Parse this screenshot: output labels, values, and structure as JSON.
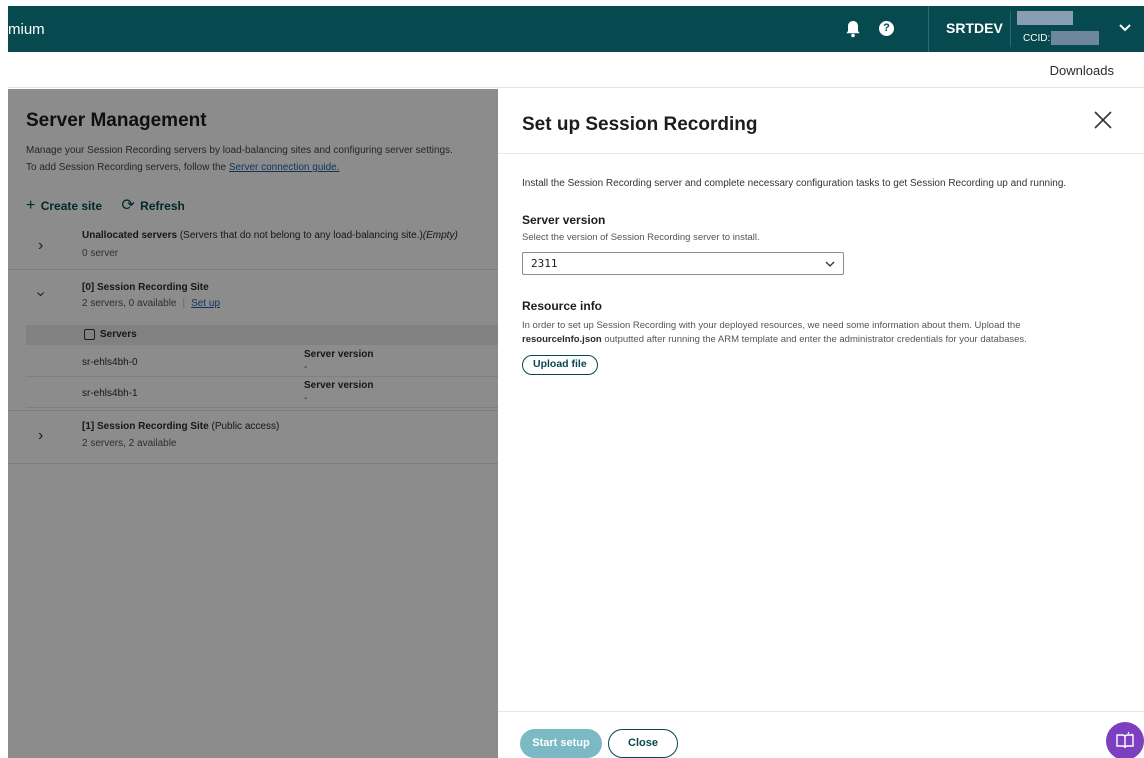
{
  "topbar": {
    "brand": "mium",
    "org": "SRTDEV",
    "ccid_label": "CCID:",
    "icons": [
      "bell-icon",
      "help-icon",
      "chevron-down-icon"
    ],
    "bg_color": "#06494f"
  },
  "subbar": {
    "downloads": "Downloads"
  },
  "left": {
    "title": "Server Management",
    "desc_line1": "Manage your Session Recording servers by load-balancing sites and configuring server settings.",
    "desc_line2_prefix": "To add Session Recording servers, follow the",
    "desc_link": "Server connection guide.",
    "create_site": "Create site",
    "refresh": "Refresh",
    "rows": [
      {
        "title": "Unallocated servers",
        "title_rest": "(Servers that do not belong to any load-balancing site.)",
        "empty": "(Empty)",
        "sub": "0 server"
      },
      {
        "title": "[0] Session Recording Site",
        "sub": "2 servers, 0 available",
        "link": "Set up"
      },
      {
        "title": "[1] Session Recording Site",
        "title_rest": "(Public access)",
        "sub": "2 servers, 2 available"
      }
    ],
    "servers_header": "Servers",
    "servers": [
      {
        "name": "sr-ehls4bh-0",
        "version_label": "Server version",
        "version_value": "-"
      },
      {
        "name": "sr-ehls4bh-1",
        "version_label": "Server version",
        "version_value": "-"
      }
    ]
  },
  "panel": {
    "title": "Set up Session Recording",
    "intro": "Install the Session Recording server and complete necessary configuration tasks to get Session Recording up and running.",
    "server_version": {
      "heading": "Server version",
      "desc": "Select the version of Session Recording server to install.",
      "selected": "2311"
    },
    "resource_info": {
      "heading": "Resource info",
      "desc_line1": "In order to set up Session Recording with your deployed resources, we need some information about them. Upload the",
      "desc_file": "resourceInfo.json",
      "desc_line2_rest": "outputted after running the ARM template and enter the administrator credentials for your databases.",
      "upload": "Upload file"
    },
    "start_setup": "Start setup",
    "close": "Close"
  }
}
